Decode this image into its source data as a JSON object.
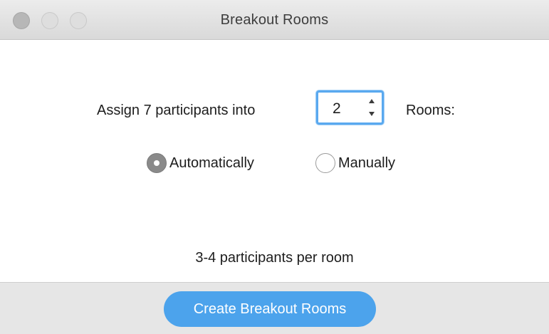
{
  "window": {
    "title": "Breakout Rooms"
  },
  "assign": {
    "prefix": "Assign 7 participants into",
    "rooms_value": "2",
    "suffix": "Rooms:"
  },
  "options": {
    "automatic_label": "Automatically",
    "manual_label": "Manually",
    "selected": "Automatically"
  },
  "summary": {
    "per_room": "3-4 participants per room"
  },
  "footer": {
    "create_label": "Create Breakout Rooms"
  },
  "colors": {
    "accent": "#4ca3ec",
    "focus_ring": "#5aa9ef"
  }
}
